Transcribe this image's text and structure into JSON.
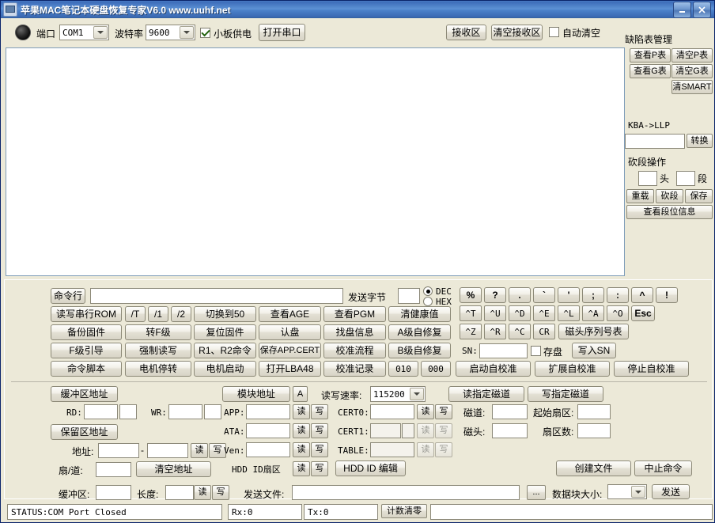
{
  "window": {
    "title": "苹果MAC笔记本硬盘恢复专家V6.0 www.uuhf.net",
    "minimize": "–",
    "close": "✕"
  },
  "toolbar": {
    "port_label": "端口",
    "port_value": "COM1",
    "baud_label": "波特率",
    "baud_value": "9600",
    "small_power_label": "小板供电",
    "open_port": "打开串口",
    "recv_zone": "接收区",
    "clear_recv_zone": "清空接收区",
    "auto_clear": "自动清空"
  },
  "receive_area": {
    "text": ""
  },
  "defect_panel": {
    "title": "缺陷表管理",
    "buttons": [
      "查看P表",
      "清空P表",
      "查看G表",
      "清空G表",
      "清SMART"
    ],
    "kba_label": "KBA->LLP",
    "kba_value": "",
    "convert": "转换",
    "cut_title": "砍段操作",
    "head_label": "头",
    "head_value": "",
    "seg_label": "段",
    "seg_value": "",
    "reload": "重载",
    "cut": "砍段",
    "save": "保存",
    "view_seg_info": "查看段位信息"
  },
  "cmd": {
    "cmdline_btn": "命令行",
    "cmdline_value": "",
    "send_bytes_label": "发送字节",
    "send_bytes_value": "",
    "dec": "DEC",
    "hex": "HEX",
    "rows": [
      [
        "读写串行ROM",
        "/T",
        "/1",
        "/2",
        "切换到50",
        "查看AGE",
        "查看PGM",
        "清健康值"
      ],
      [
        "备份固件",
        "转F级",
        "复位固件",
        "认盘",
        "找盘信息",
        "A级自修复"
      ],
      [
        "F级引导",
        "强制读写",
        "R1、R2命令",
        "保存APP.CERT",
        "校准流程",
        "B级自修复"
      ],
      [
        "命令脚本",
        "电机停转",
        "电机启动",
        "打开LBA48",
        "校准记录",
        "010",
        "000"
      ]
    ]
  },
  "keypad": {
    "row1": [
      "%",
      "?",
      ".",
      "`",
      "'",
      ";",
      ":",
      "^",
      "!"
    ],
    "row2": [
      "^T",
      "^U",
      "^D",
      "^E",
      "^L",
      "^A",
      "^O",
      "Esc"
    ],
    "row3": [
      "^Z",
      "^R",
      "^C",
      "CR",
      "磁头序列号表"
    ],
    "sn_label": "SN:",
    "sn_value": "",
    "save_disk": "存盘",
    "write_sn": "写入SN",
    "start_selfcal": "启动自校准",
    "extend_selfcal": "扩展自校准",
    "stop_selfcal": "停止自校准"
  },
  "buffer": {
    "buffer_addr_btn": "缓冲区地址",
    "rd_label": "RD:",
    "rd_value": "",
    "rd_extra": "",
    "wr_label": "WR:",
    "wr_value": "",
    "wr_extra": "",
    "reserve_addr_btn": "保留区地址",
    "addr_label": "地址:",
    "addr_from": "",
    "addr_dash": "-",
    "addr_to": "",
    "read": "读",
    "write": "写",
    "sector_track_label": "扇/道:",
    "sector_track_value": "",
    "clear_addr": "清空地址"
  },
  "module": {
    "module_addr_btn": "模块地址",
    "a_btn": "A",
    "speed_label": "读写速率:",
    "speed_value": "115200",
    "rows": [
      {
        "label": "APP:",
        "value": "",
        "read": "读",
        "write": "写"
      },
      {
        "label": "ATA:",
        "value": "",
        "read": "读",
        "write": "写"
      },
      {
        "label": "Ven:",
        "value": "",
        "read": "读",
        "write": "写"
      }
    ],
    "hdd_id_sector_label": "HDD ID扇区",
    "hdd_id_read": "读",
    "hdd_id_write": "写",
    "cert_rows": [
      {
        "label": "CERT0:",
        "value": "",
        "extra": null,
        "read": "读",
        "write": "写",
        "disabled": false
      },
      {
        "label": "CERT1:",
        "value": "",
        "extra": "",
        "read": "读",
        "write": "写",
        "disabled": true
      },
      {
        "label": "TABLE:",
        "value": "",
        "extra": null,
        "read": "读",
        "write": "写",
        "disabled": true
      }
    ],
    "hdd_id_edit": "HDD ID 编辑"
  },
  "track": {
    "read_track_btn": "读指定磁道",
    "write_track_btn": "写指定磁道",
    "track_label": "磁道:",
    "track_value": "",
    "start_sector_label": "起始扇区:",
    "start_sector_value": "",
    "head_label": "磁头:",
    "head_value": "",
    "sector_count_label": "扇区数:",
    "sector_count_value": "",
    "create_file": "创建文件",
    "abort_cmd": "中止命令"
  },
  "sendrow": {
    "buffer_label": "缓冲区:",
    "buffer_value": "",
    "length_label": "长度:",
    "length_value": "",
    "read": "读",
    "write": "写",
    "send_file_label": "发送文件:",
    "send_file_value": "",
    "browse": "...",
    "block_size_label": "数据块大小:",
    "block_size_value": "",
    "send": "发送"
  },
  "status": {
    "status_text": "STATUS:COM Port Closed",
    "rx": "Rx:0",
    "tx": "Tx:0",
    "reset_count": "计数清零"
  }
}
